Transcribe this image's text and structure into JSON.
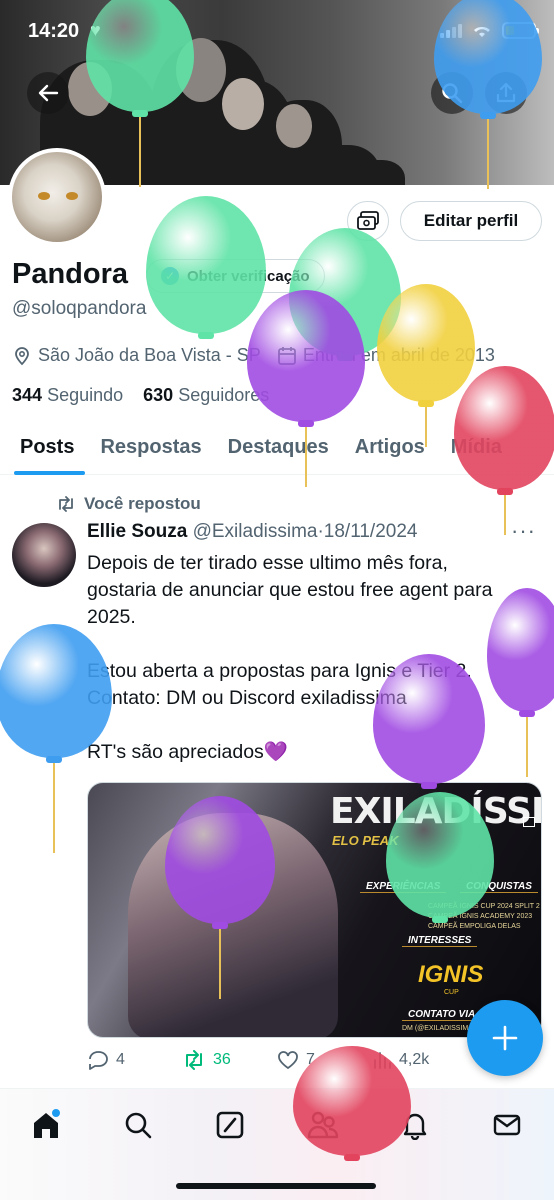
{
  "status_bar": {
    "time": "14:20"
  },
  "profile": {
    "name": "Pandora",
    "verify_label": "Obter verificação",
    "handle": "@soloqpandora",
    "location": "São João da Boa Vista - SP",
    "joined": "Entrou em abril de 2013",
    "following_count": "344",
    "following_label": "Seguindo",
    "followers_count": "630",
    "followers_label": "Seguidores",
    "edit_button": "Editar perfil"
  },
  "tabs": [
    "Posts",
    "Respostas",
    "Destaques",
    "Artigos",
    "Mídia"
  ],
  "post": {
    "repost_label": "Você repostou",
    "author": "Ellie Souza",
    "handle": "@Exiladissima",
    "date": "18/11/2024",
    "text_line1": "Depois de ter tirado esse ultimo mês fora,",
    "text_line2": "gostaria de anunciar que estou free agent para",
    "text_line3": "2025.",
    "text_line4": "Estou aberta a propostas para Ignis e Tier 2.",
    "text_line5": "Contato: DM ou Discord exiladissima",
    "text_line6": "RT's são apreciados💜",
    "media": {
      "title": "EXILADÍSSIMA",
      "subtitle": "ELO PEAK",
      "experiences": "EXPERIÊNCIAS",
      "achievements": "CONQUISTAS",
      "achievement_1": "CAMPEÃ IGNIS CUP 2024 SPLIT 2",
      "achievement_2": "CAMPEÃ IGNIS ACADEMY 2023",
      "achievement_3": "CAMPEÃ EMPOLIGA DELAS",
      "interests": "INTERESSES",
      "ignis": "IGNIS",
      "cup": "CUP",
      "contact": "CONTATO VIA",
      "contact_line": "DM (@EXILADISSIMA)"
    },
    "replies": "4",
    "reposts": "36",
    "likes": "7",
    "views": "4,2k"
  },
  "colors": {
    "accent": "#1d9bf0",
    "balloon_green": "#5fe3a6",
    "balloon_purple": "#a04be2",
    "balloon_blue": "#3f9df0",
    "balloon_yellow": "#f1d03e",
    "balloon_red": "#e2445e"
  }
}
